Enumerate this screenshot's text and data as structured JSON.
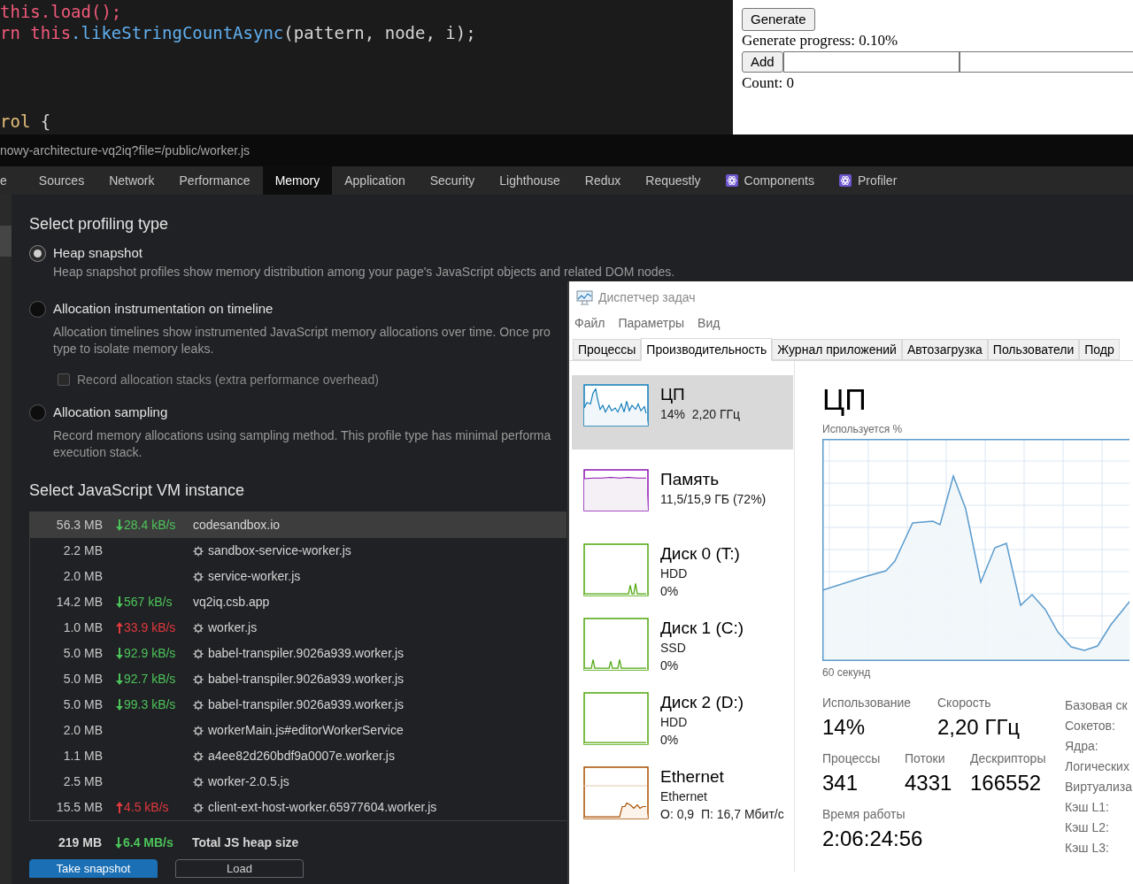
{
  "editor": {
    "lines": [
      [
        {
          "kind": "keyword",
          "text": "this"
        },
        {
          "kind": "keyword",
          "text": ".load();"
        }
      ],
      [
        {
          "kind": "keyword",
          "text": "rn this"
        },
        {
          "kind": "function",
          "text": ".likeStringCountAsync"
        },
        {
          "kind": "plain",
          "text": "(pattern, node, i);"
        }
      ],
      [
        {
          "kind": "type",
          "text": "rol"
        },
        {
          "kind": "plain",
          "text": " {"
        }
      ]
    ]
  },
  "preview": {
    "generate_button": "Generate",
    "progress": "Generate progress: 0.10%",
    "add_button": "Add",
    "count": "Count: 0"
  },
  "address_bar": "nowy-architecture-vq2iq?file=/public/worker.js",
  "devtools": {
    "tabs": [
      {
        "label": "e",
        "selected": false,
        "icon": false
      },
      {
        "label": "Sources",
        "selected": false,
        "icon": false
      },
      {
        "label": "Network",
        "selected": false,
        "icon": false
      },
      {
        "label": "Performance",
        "selected": false,
        "icon": false
      },
      {
        "label": "Memory",
        "selected": true,
        "icon": false
      },
      {
        "label": "Application",
        "selected": false,
        "icon": false
      },
      {
        "label": "Security",
        "selected": false,
        "icon": false
      },
      {
        "label": "Lighthouse",
        "selected": false,
        "icon": false
      },
      {
        "label": "Redux",
        "selected": false,
        "icon": false
      },
      {
        "label": "Requestly",
        "selected": false,
        "icon": false
      },
      {
        "label": "Components",
        "selected": false,
        "icon": true
      },
      {
        "label": "Profiler",
        "selected": false,
        "icon": true
      }
    ],
    "profiling": {
      "title": "Select profiling type",
      "options": [
        {
          "label": "Heap snapshot",
          "selected": true,
          "description": [
            "Heap snapshot profiles show memory distribution among your page's JavaScript objects and related DOM nodes."
          ]
        },
        {
          "label": "Allocation instrumentation on timeline",
          "selected": false,
          "description": [
            "Allocation timelines show instrumented JavaScript memory allocations over time. Once pro",
            "type to isolate memory leaks."
          ],
          "checkbox": {
            "label": "Record allocation stacks (extra performance overhead)",
            "checked": false
          }
        },
        {
          "label": "Allocation sampling",
          "selected": false,
          "description": [
            "Record memory allocations using sampling method. This profile type has minimal performa",
            "execution stack."
          ]
        }
      ]
    },
    "vm": {
      "title": "Select JavaScript VM instance",
      "rows": [
        {
          "size": "56.3 MB",
          "rising": false,
          "rate": "28.4 kB/s",
          "worker": false,
          "name": "codesandbox.io",
          "selected": true
        },
        {
          "size": "2.2 MB",
          "worker": true,
          "name": "sandbox-service-worker.js",
          "selected": false
        },
        {
          "size": "2.0 MB",
          "worker": true,
          "name": "service-worker.js",
          "selected": false
        },
        {
          "size": "14.2 MB",
          "rising": false,
          "rate": "567 kB/s",
          "worker": false,
          "name": "vq2iq.csb.app",
          "selected": false
        },
        {
          "size": "1.0 MB",
          "rising": true,
          "rate": "33.9 kB/s",
          "worker": true,
          "name": "worker.js",
          "selected": false
        },
        {
          "size": "5.0 MB",
          "rising": false,
          "rate": "92.9 kB/s",
          "worker": true,
          "name": "babel-transpiler.9026a939.worker.js",
          "selected": false
        },
        {
          "size": "5.0 MB",
          "rising": false,
          "rate": "92.7 kB/s",
          "worker": true,
          "name": "babel-transpiler.9026a939.worker.js",
          "selected": false
        },
        {
          "size": "5.0 MB",
          "rising": false,
          "rate": "99.3 kB/s",
          "worker": true,
          "name": "babel-transpiler.9026a939.worker.js",
          "selected": false
        },
        {
          "size": "2.0 MB",
          "worker": true,
          "name": "workerMain.js#editorWorkerService",
          "selected": false
        },
        {
          "size": "1.1 MB",
          "worker": true,
          "name": "a4ee82d260bdf9a0007e.worker.js",
          "selected": false
        },
        {
          "size": "2.5 MB",
          "worker": true,
          "name": "worker-2.0.5.js",
          "selected": false
        },
        {
          "size": "15.5 MB",
          "rising": true,
          "rate": "4.5 kB/s",
          "worker": true,
          "name": "client-ext-host-worker.65977604.worker.js",
          "selected": false
        }
      ],
      "total": {
        "size": "219 MB",
        "rising": false,
        "rate": "6.4 MB/s",
        "label": "Total JS heap size"
      }
    },
    "buttons": [
      {
        "label": "Take snapshot",
        "kind": "primary"
      },
      {
        "label": "Load",
        "kind": "secondary"
      }
    ]
  },
  "task_manager": {
    "title": "Диспетчер задач",
    "menu": [
      "Файл",
      "Параметры",
      "Вид"
    ],
    "tabs": [
      {
        "label": "Процессы",
        "selected": false
      },
      {
        "label": "Производительность",
        "selected": true
      },
      {
        "label": "Журнал приложений",
        "selected": false
      },
      {
        "label": "Автозагрузка",
        "selected": false
      },
      {
        "label": "Пользователи",
        "selected": false
      },
      {
        "label": "Подр",
        "selected": false
      }
    ],
    "resources": [
      {
        "kind": "cpu",
        "name": "ЦП",
        "details": [
          "14%  2,20 ГГц"
        ],
        "selected": true
      },
      {
        "kind": "memory",
        "name": "Память",
        "details": [
          "11,5/15,9 ГБ (72%)"
        ],
        "selected": false
      },
      {
        "kind": "disk",
        "name": "Диск 0 (T:)",
        "details": [
          "HDD",
          "0%"
        ],
        "selected": false
      },
      {
        "kind": "disk",
        "name": "Диск 1 (C:)",
        "details": [
          "SSD",
          "0%"
        ],
        "selected": false
      },
      {
        "kind": "disk",
        "name": "Диск 2 (D:)",
        "details": [
          "HDD",
          "0%"
        ],
        "selected": false
      },
      {
        "kind": "ethernet",
        "name": "Ethernet",
        "details": [
          "Ethernet",
          "О: 0,9  П: 16,7 Мбит/с"
        ],
        "selected": false
      }
    ],
    "detail": {
      "title": "ЦП",
      "chart_label": "Используется %",
      "time_label": "60 секунд",
      "stats_row_1": [
        {
          "label": "Использование",
          "value": "14%"
        },
        {
          "label": "Скорость",
          "value": "2,20 ГГц"
        }
      ],
      "stats_row_2": [
        {
          "label": "Процессы",
          "value": "341"
        },
        {
          "label": "Потоки",
          "value": "4331"
        },
        {
          "label": "Дескрипторы",
          "value": "166552"
        }
      ],
      "uptime": {
        "label": "Время работы",
        "value": "2:06:24:56"
      },
      "specs": [
        "Базовая ск",
        "Сокетов:",
        "Ядра:",
        "Логических",
        "Виртуализа",
        "Кэш L1:",
        "Кэш L2:",
        "Кэш L3:"
      ]
    }
  }
}
